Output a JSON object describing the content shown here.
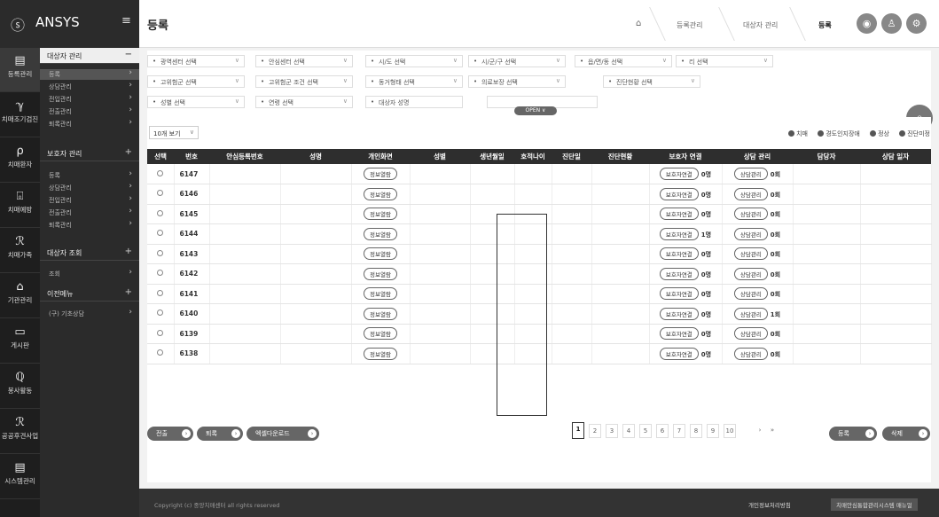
{
  "brand": {
    "name": "ANSYS",
    "logo_icon": "ⓢ",
    "menu_icon": "≡"
  },
  "header": {
    "title": "등록",
    "breadcrumbs": [
      "등록관리",
      "대상자 관리",
      "등록"
    ]
  },
  "sidebar": [
    {
      "label": "등록관리",
      "icon": "▤"
    },
    {
      "label": "치매조기검진",
      "icon": "ℽ"
    },
    {
      "label": "치매환자",
      "icon": "⍴"
    },
    {
      "label": "치매예방",
      "icon": "⌻"
    },
    {
      "label": "치매가족",
      "icon": "ℛ"
    },
    {
      "label": "기관관리",
      "icon": "⌂"
    },
    {
      "label": "게시판",
      "icon": "▭"
    },
    {
      "label": "봉사활동",
      "icon": "ℚ"
    },
    {
      "label": "공공후견사업",
      "icon": "ℛ"
    },
    {
      "label": "시스템관리",
      "icon": "▤"
    }
  ],
  "submenu": {
    "sec1": {
      "title": "대상자 관리",
      "toggle": "−",
      "items": [
        "등록",
        "상담관리",
        "전입관리",
        "전출관리",
        "퇴록관리"
      ]
    },
    "sec2": {
      "title": "보호자 관리",
      "toggle": "+",
      "items": [
        "등록",
        "상담관리",
        "전입관리",
        "전출관리",
        "퇴록관리"
      ]
    },
    "sec3": {
      "title": "대상자 조회",
      "toggle": "+",
      "items": [
        "조회"
      ]
    },
    "sec4": {
      "title": "이전메뉴",
      "toggle": "+",
      "items": [
        "(구) 기초상담"
      ]
    }
  },
  "filters": {
    "row1": [
      "광역센터 선택",
      "안심센터 선택",
      "시/도 선택",
      "시/군/구 선택",
      "읍/면/동 선택",
      "리 선택"
    ],
    "row2": [
      "고위험군 선택",
      "고위험군 조건 선택",
      "동거형태 선택",
      "의료보장 선택",
      "진단현황 선택"
    ],
    "row3": [
      "성별 선택",
      "연령 선택",
      "대상자 성명"
    ],
    "open_label": "OPEN ∨"
  },
  "page_size": "10개 보기",
  "legend": [
    "치매",
    "경도인지장애",
    "정상",
    "진단미정"
  ],
  "table": {
    "headers": [
      "선택",
      "번호",
      "안심등록번호",
      "성명",
      "개인화면",
      "성별",
      "생년월일",
      "호적나이",
      "진단일",
      "진단현황",
      "보호자 연결",
      "상담 관리",
      "담당자",
      "상담 일자"
    ],
    "rows": [
      {
        "no": "6147",
        "guardian": "0명",
        "counsel": "0회"
      },
      {
        "no": "6146",
        "guardian": "0명",
        "counsel": "0회"
      },
      {
        "no": "6145",
        "guardian": "0명",
        "counsel": "0회"
      },
      {
        "no": "6144",
        "guardian": "1명",
        "counsel": "0회"
      },
      {
        "no": "6143",
        "guardian": "0명",
        "counsel": "0회"
      },
      {
        "no": "6142",
        "guardian": "0명",
        "counsel": "0회"
      },
      {
        "no": "6141",
        "guardian": "0명",
        "counsel": "0회"
      },
      {
        "no": "6140",
        "guardian": "0명",
        "counsel": "1회"
      },
      {
        "no": "6139",
        "guardian": "0명",
        "counsel": "0회"
      },
      {
        "no": "6138",
        "guardian": "0명",
        "counsel": "0회"
      }
    ],
    "view_btn": "정보열람",
    "guardian_btn": "보호자연결",
    "counsel_btn": "상담관리"
  },
  "actions": {
    "transfer": "전출",
    "remove": "퇴록",
    "excel": "엑셀다운로드",
    "register": "등록",
    "delete": "삭제"
  },
  "pager": {
    "pages": [
      "1",
      "2",
      "3",
      "4",
      "5",
      "6",
      "7",
      "8",
      "9",
      "10"
    ],
    "next": "›",
    "last": "»"
  },
  "footer": {
    "copyright": "Copyright (c) 중앙치매센터 all rights reserved",
    "link1": "개인정보처리방침",
    "link2": "치매안심통합관리시스템 매뉴얼"
  }
}
